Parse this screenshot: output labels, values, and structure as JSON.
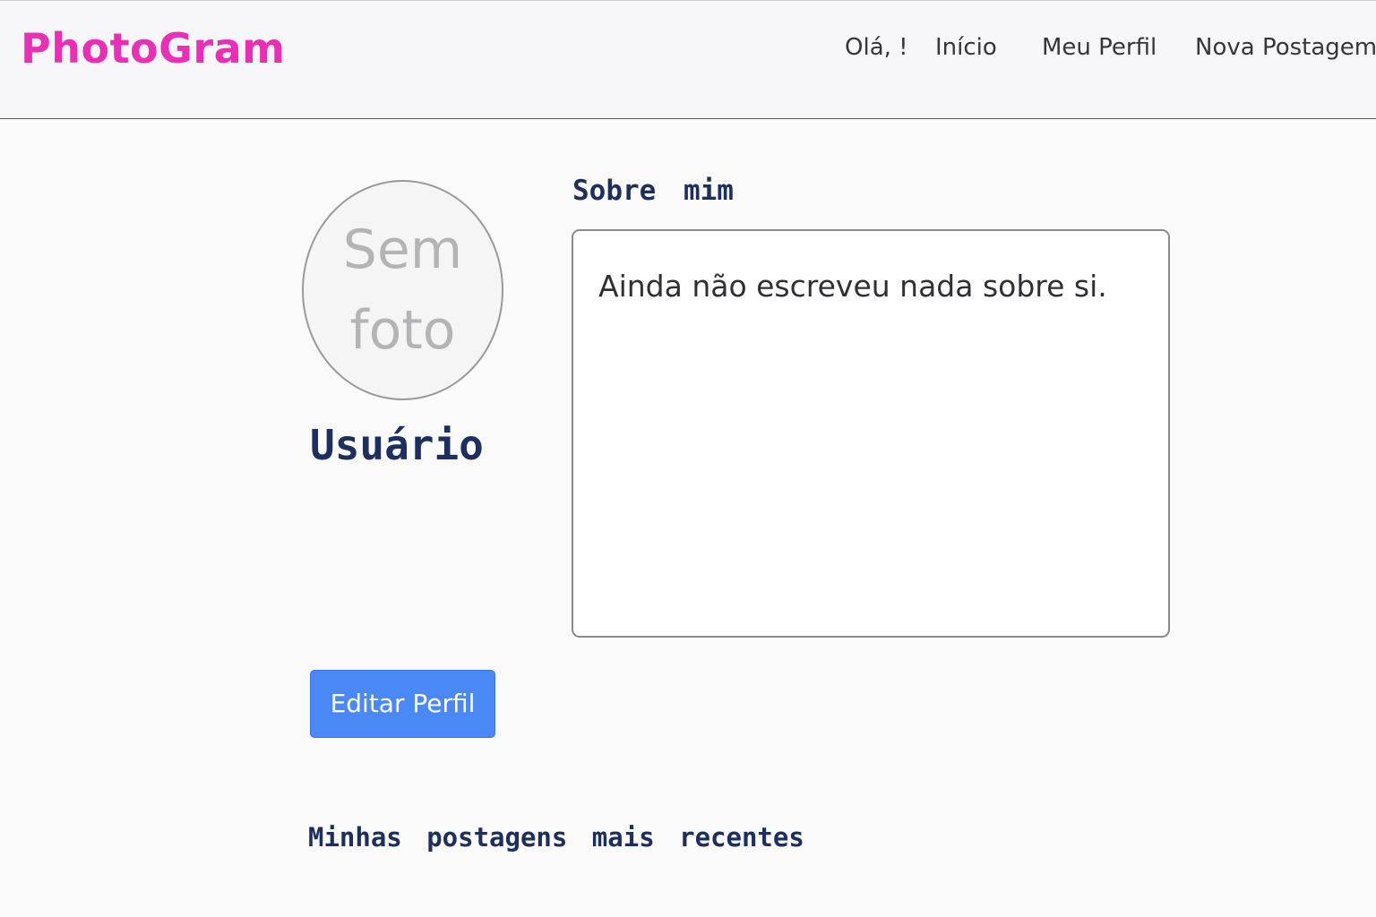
{
  "header": {
    "brand": "PhotoGram",
    "greeting": "Olá, !",
    "nav": {
      "home": "Início",
      "profile": "Meu Perfil",
      "new_post": "Nova Postagem"
    }
  },
  "profile": {
    "avatar_placeholder": [
      "Sem",
      "foto"
    ],
    "username": "Usuário",
    "edit_button": "Editar Perfil"
  },
  "about": {
    "title": "Sobre mim",
    "text": "Ainda não escreveu nada sobre si."
  },
  "posts": {
    "title": "Minhas postagens mais recentes"
  },
  "colors": {
    "brand": "#ea2fb6",
    "heading": "#1c2f5f",
    "button": "#4a88f5"
  }
}
